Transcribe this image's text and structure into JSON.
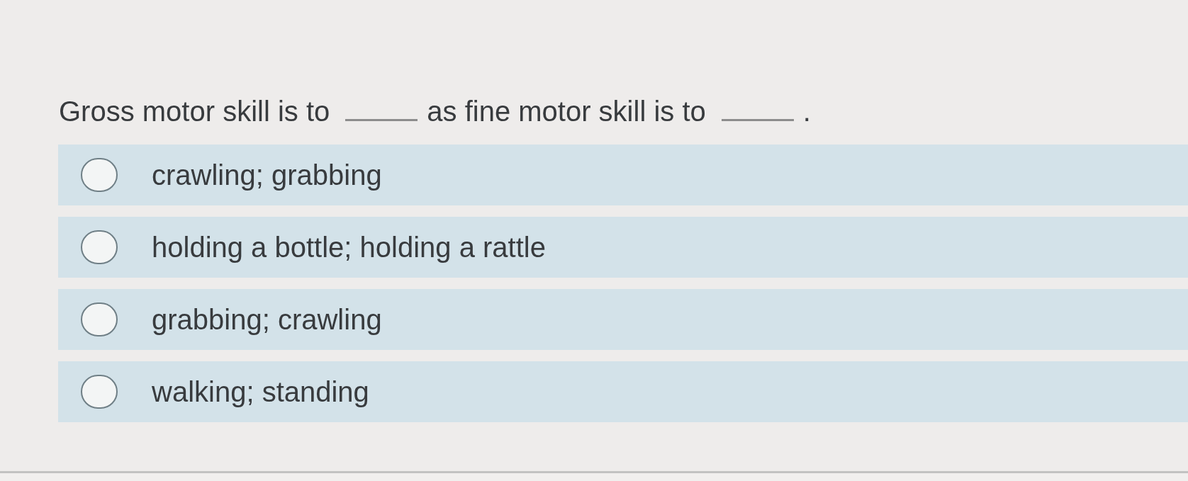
{
  "question": {
    "segments": [
      {
        "kind": "text",
        "text": "Gross motor skill is to"
      },
      {
        "kind": "blank"
      },
      {
        "kind": "text",
        "text": "as fine motor skill is to"
      },
      {
        "kind": "blank"
      },
      {
        "kind": "text",
        "text": "."
      }
    ]
  },
  "options": [
    {
      "label": "crawling; grabbing",
      "selected": false
    },
    {
      "label": "holding a bottle; holding a rattle",
      "selected": false
    },
    {
      "label": "grabbing; crawling",
      "selected": false
    },
    {
      "label": "walking; standing",
      "selected": false
    }
  ]
}
